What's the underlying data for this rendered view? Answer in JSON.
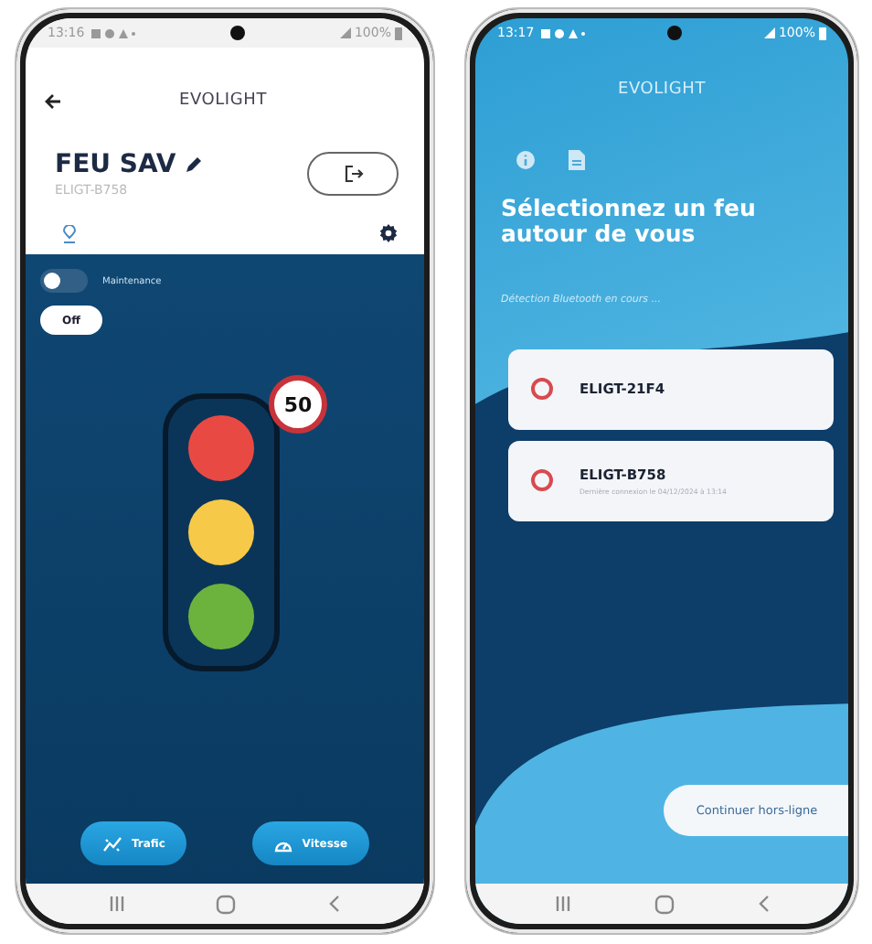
{
  "phones": [
    {
      "kind": "control",
      "status_bar": {
        "time": "13:16",
        "battery": "100%"
      },
      "app_title": "EVOLIGHT",
      "device_name": "FEU SAV",
      "device_id": "ELIGT-B758",
      "maintenance": {
        "label": "Maintenance",
        "on": false
      },
      "mode_button": "Off",
      "speed_limit": "50",
      "lights": [
        {
          "color": "#e84a43"
        },
        {
          "color": "#f7c948"
        },
        {
          "color": "#6cb33e"
        }
      ],
      "actions": [
        {
          "kind": "traffic",
          "label": "Trafic"
        },
        {
          "kind": "speed",
          "label": "Vitesse"
        }
      ]
    },
    {
      "kind": "scan",
      "status_bar": {
        "time": "13:17",
        "battery": "100%"
      },
      "app_title": "EVOLIGHT",
      "heading": "Sélectionnez un feu autour de vous",
      "status": "Détection Bluetooth en cours ...",
      "devices": [
        {
          "name": "ELIGT-21F4",
          "selected": false
        },
        {
          "name": "ELIGT-B758",
          "subtitle": "Dernière connexion le 04/12/2024 à 13:14",
          "selected": false
        }
      ],
      "offline_button": "Continuer hors-ligne"
    }
  ]
}
